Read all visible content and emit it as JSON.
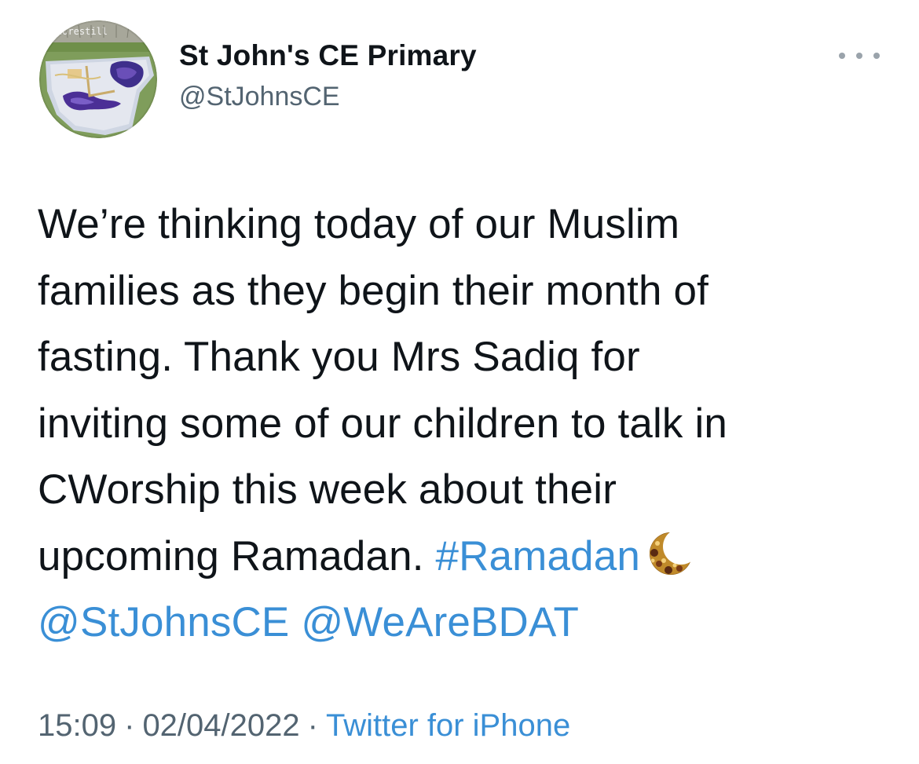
{
  "author": {
    "name": "St John's CE Primary",
    "handle": "@StJohnsCE",
    "avatar_icon": "school-mosaic-avatar",
    "avatar_banner_text": "norestill"
  },
  "tweet": {
    "lines": [
      "We’re thinking today of our Muslim",
      "families as they begin their month of",
      "fasting. Thank you Mrs Sadiq for",
      "inviting some of our children to talk in",
      "CWorship this week about their"
    ],
    "line6_text": "upcoming Ramadan. ",
    "hashtag": "#Ramadan",
    "emoji": "crescent-moon-icon",
    "mention_1": "@StJohnsCE",
    "mention_2": "@WeAreBDAT"
  },
  "meta": {
    "time": "15:09",
    "date": "02/04/2022",
    "separator": "·",
    "source": "Twitter for iPhone"
  },
  "colors": {
    "link": "#3a8fd6",
    "text": "#0f1419",
    "secondary": "#536471"
  }
}
